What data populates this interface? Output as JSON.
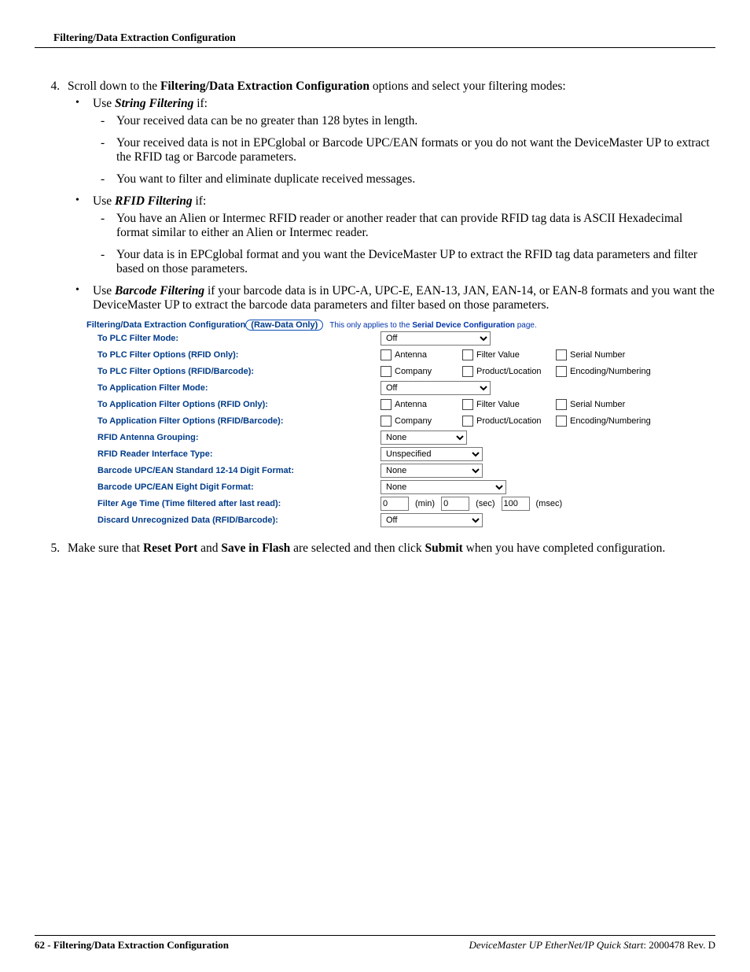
{
  "header": "Filtering/Data Extraction Configuration",
  "step4": {
    "intro_a": "Scroll down to the ",
    "intro_b": "Filtering/Data Extraction Configuration",
    "intro_c": " options and select your filtering modes:",
    "string_use": "Use ",
    "string_name": "String Filtering",
    "string_if": " if:",
    "string_b1": "Your received data can be no greater than 128 bytes in length.",
    "string_b2": "Your received data is not in EPCglobal or Barcode UPC/EAN formats or you do not want the DeviceMaster UP to extract the RFID tag or Barcode parameters.",
    "string_b3": "You want to filter and eliminate duplicate received messages.",
    "rfid_use": "Use ",
    "rfid_name": "RFID Filtering",
    "rfid_if": " if:",
    "rfid_b1": "You have an Alien or Intermec RFID reader or another reader that can provide RFID tag data is ASCII Hexadecimal format similar to either an Alien or Intermec reader.",
    "rfid_b2": "Your data is in EPCglobal format and you want the DeviceMaster UP to extract the RFID tag data parameters and filter based on those parameters.",
    "barcode_use": "Use ",
    "barcode_name": "Barcode Filtering",
    "barcode_text": " if your barcode data is in UPC-A, UPC-E, EAN-13, JAN, EAN-14, or EAN-8 formats and you want the DeviceMaster UP to extract the barcode data parameters and filter based on those parameters."
  },
  "cfg": {
    "title_a": "Filtering/Data Extraction Configuration",
    "title_b": "(Raw-Data Only)",
    "note_a": "This only applies to the ",
    "note_b": "Serial Device Configuration",
    "note_c": " page.",
    "rows": {
      "plc_mode": "To PLC Filter Mode:",
      "plc_rfid": "To PLC Filter Options (RFID Only):",
      "plc_rfidbar": "To PLC Filter Options (RFID/Barcode):",
      "app_mode": "To Application Filter Mode:",
      "app_rfid": "To Application Filter Options (RFID Only):",
      "app_rfidbar": "To Application Filter Options (RFID/Barcode):",
      "ant_group": "RFID Antenna Grouping:",
      "reader_type": "RFID Reader Interface Type:",
      "upc1214": "Barcode UPC/EAN Standard 12-14 Digit Format:",
      "upc8": "Barcode UPC/EAN Eight Digit Format:",
      "filter_age": "Filter Age Time (Time filtered after last read):",
      "discard": "Discard Unrecognized Data (RFID/Barcode):"
    },
    "cb": {
      "antenna": "Antenna",
      "filter_value": "Filter Value",
      "serial": "Serial Number",
      "company": "Company",
      "prodloc": "Product/Location",
      "encnum": "Encoding/Numbering"
    },
    "sel": {
      "off": "Off",
      "none": "None",
      "unspecified": "Unspecified"
    },
    "age": {
      "v1": "0",
      "u1": "(min)",
      "v2": "0",
      "u2": "(sec)",
      "v3": "100",
      "u3": "(msec)"
    }
  },
  "step5": {
    "a": "Make sure that ",
    "b": "Reset Port",
    "c": " and ",
    "d": "Save in Flash",
    "e": " are selected and then click ",
    "f": "Submit",
    "g": " when you have completed configuration."
  },
  "footer": {
    "left": "62 -  Filtering/Data Extraction Configuration",
    "right_a": "DeviceMaster UP EtherNet/IP Quick Start",
    "right_b": ": 2000478 Rev. D"
  }
}
